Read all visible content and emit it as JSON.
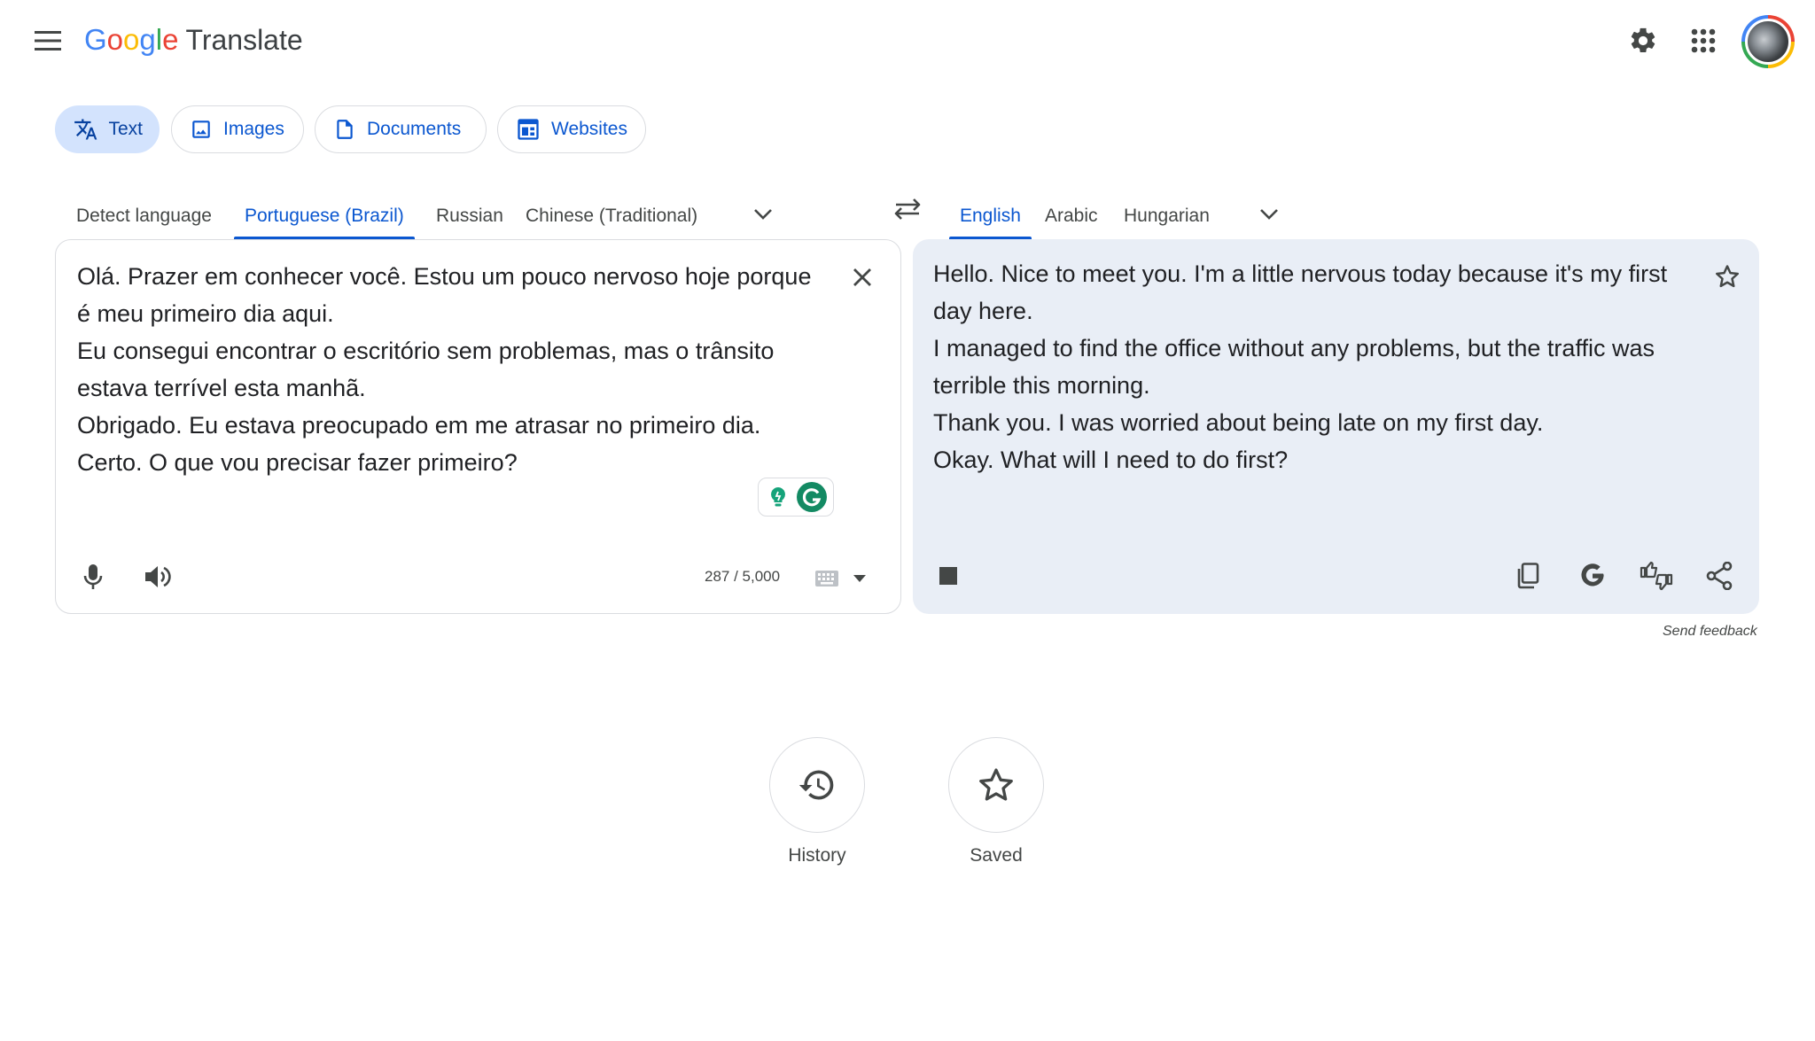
{
  "app": {
    "logo_letters": [
      {
        "ch": "G",
        "color": "#4285f4"
      },
      {
        "ch": "o",
        "color": "#ea4335"
      },
      {
        "ch": "o",
        "color": "#fbbc05"
      },
      {
        "ch": "g",
        "color": "#4285f4"
      },
      {
        "ch": "l",
        "color": "#34a853"
      },
      {
        "ch": "e",
        "color": "#ea4335"
      }
    ],
    "product_name": "Translate"
  },
  "modes": {
    "text": "Text",
    "images": "Images",
    "documents": "Documents",
    "websites": "Websites",
    "active": "Text"
  },
  "source_languages": {
    "detect": "Detect language",
    "portuguese": "Portuguese (Brazil)",
    "russian": "Russian",
    "chinese": "Chinese (Traditional)",
    "selected": "Portuguese (Brazil)"
  },
  "target_languages": {
    "english": "English",
    "arabic": "Arabic",
    "hungarian": "Hungarian",
    "selected": "English"
  },
  "source": {
    "lines": [
      "Olá. Prazer em conhecer você. Estou um pouco nervoso hoje porque é meu primeiro dia aqui.",
      "Eu consegui encontrar o escritório sem problemas, mas o trânsito estava terrível esta manhã.",
      "Obrigado. Eu estava preocupado em me atrasar no primeiro dia.",
      "Certo. O que vou precisar fazer primeiro?"
    ],
    "char_count": "287 / 5,000"
  },
  "target": {
    "lines": [
      "Hello. Nice to meet you. I'm a little nervous today because it's my first day here.",
      "I managed to find the office without any problems, but the traffic was terrible this morning.",
      "Thank you. I was worried about being late on my first day.",
      "Okay. What will I need to do first?"
    ],
    "feedback": "Send feedback"
  },
  "bottom": {
    "history": "History",
    "saved": "Saved"
  },
  "colors": {
    "accent": "#0b57d0",
    "active_chip_bg": "#d3e3fd",
    "target_panel_bg": "#e9eef6",
    "grammarly_green": "#15c39a"
  }
}
